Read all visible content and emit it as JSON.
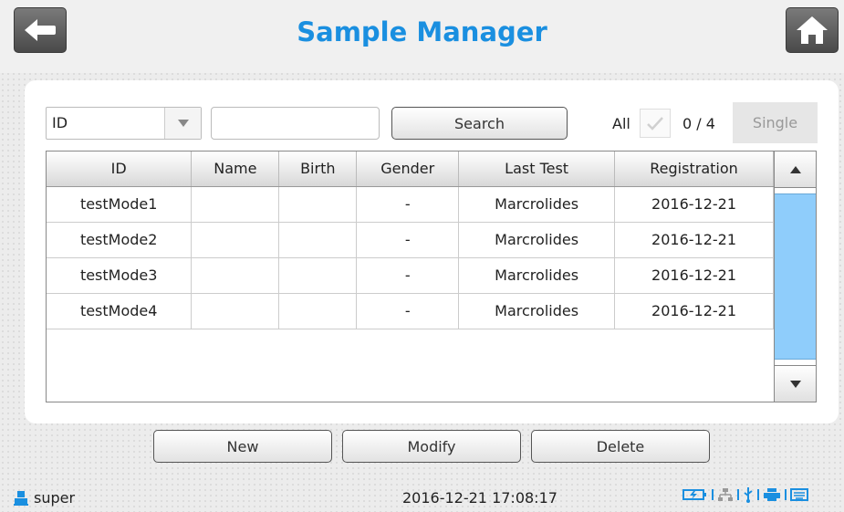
{
  "header": {
    "title": "Sample Manager"
  },
  "filter": {
    "field_value": "ID",
    "search_value": "",
    "search_label": "Search",
    "all_label": "All",
    "count": "0 / 4",
    "single_label": "Single"
  },
  "table": {
    "columns": [
      "ID",
      "Name",
      "Birth",
      "Gender",
      "Last Test",
      "Registration"
    ],
    "rows": [
      [
        "testMode1",
        "",
        "",
        "-",
        "Marcrolides",
        "2016-12-21"
      ],
      [
        "testMode2",
        "",
        "",
        "-",
        "Marcrolides",
        "2016-12-21"
      ],
      [
        "testMode3",
        "",
        "",
        "-",
        "Marcrolides",
        "2016-12-21"
      ],
      [
        "testMode4",
        "",
        "",
        "-",
        "Marcrolides",
        "2016-12-21"
      ]
    ]
  },
  "actions": {
    "new_label": "New",
    "modify_label": "Modify",
    "delete_label": "Delete"
  },
  "status": {
    "user": "super",
    "datetime": "2016-12-21 17:08:17"
  },
  "colors": {
    "accent": "#1a8fe0",
    "scroll_thumb": "#8fcdfb"
  },
  "icons": [
    "back-arrow-icon",
    "home-icon",
    "dropdown-arrow-icon",
    "check-icon",
    "scroll-up-icon",
    "scroll-down-icon",
    "user-icon",
    "battery-icon",
    "network-icon",
    "usb-icon",
    "printer-icon",
    "keyboard-icon"
  ]
}
